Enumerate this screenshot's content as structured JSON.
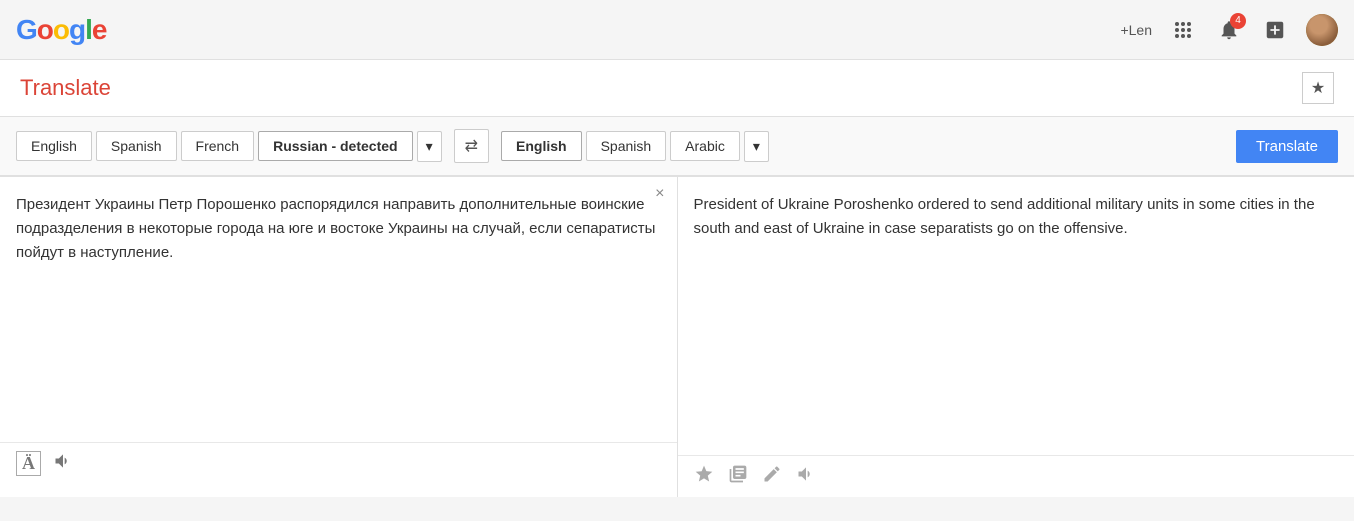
{
  "header": {
    "logo": "Google",
    "user_label": "+Len",
    "notification_count": "4",
    "page_title": "Translate",
    "star_aria": "Star"
  },
  "lang_bar_left": {
    "options": [
      "English",
      "Spanish",
      "French",
      "Russian - detected"
    ],
    "active": "Russian - detected",
    "dropdown_arrow": "▾"
  },
  "lang_bar_right": {
    "options": [
      "English",
      "Spanish",
      "Arabic"
    ],
    "active": "English",
    "dropdown_arrow": "▾",
    "translate_btn": "Translate"
  },
  "swap_symbol": "⇄",
  "input_text": "Президент Украины Петр Порошенко распорядился направить дополнительные воинские подразделения в некоторые города на юге и востоке Украины на случай, если сепаратисты пойдут в наступление.",
  "output_text": "President of Ukraine Poroshenko ordered to send additional military units in some cities in the south and east of Ukraine in case separatists go on the offensive.",
  "footer_left_icons": [
    "font-icon",
    "speaker-icon"
  ],
  "footer_right_icons": [
    "star-icon",
    "list-icon",
    "edit-icon",
    "speaker-icon"
  ],
  "close_symbol": "×"
}
